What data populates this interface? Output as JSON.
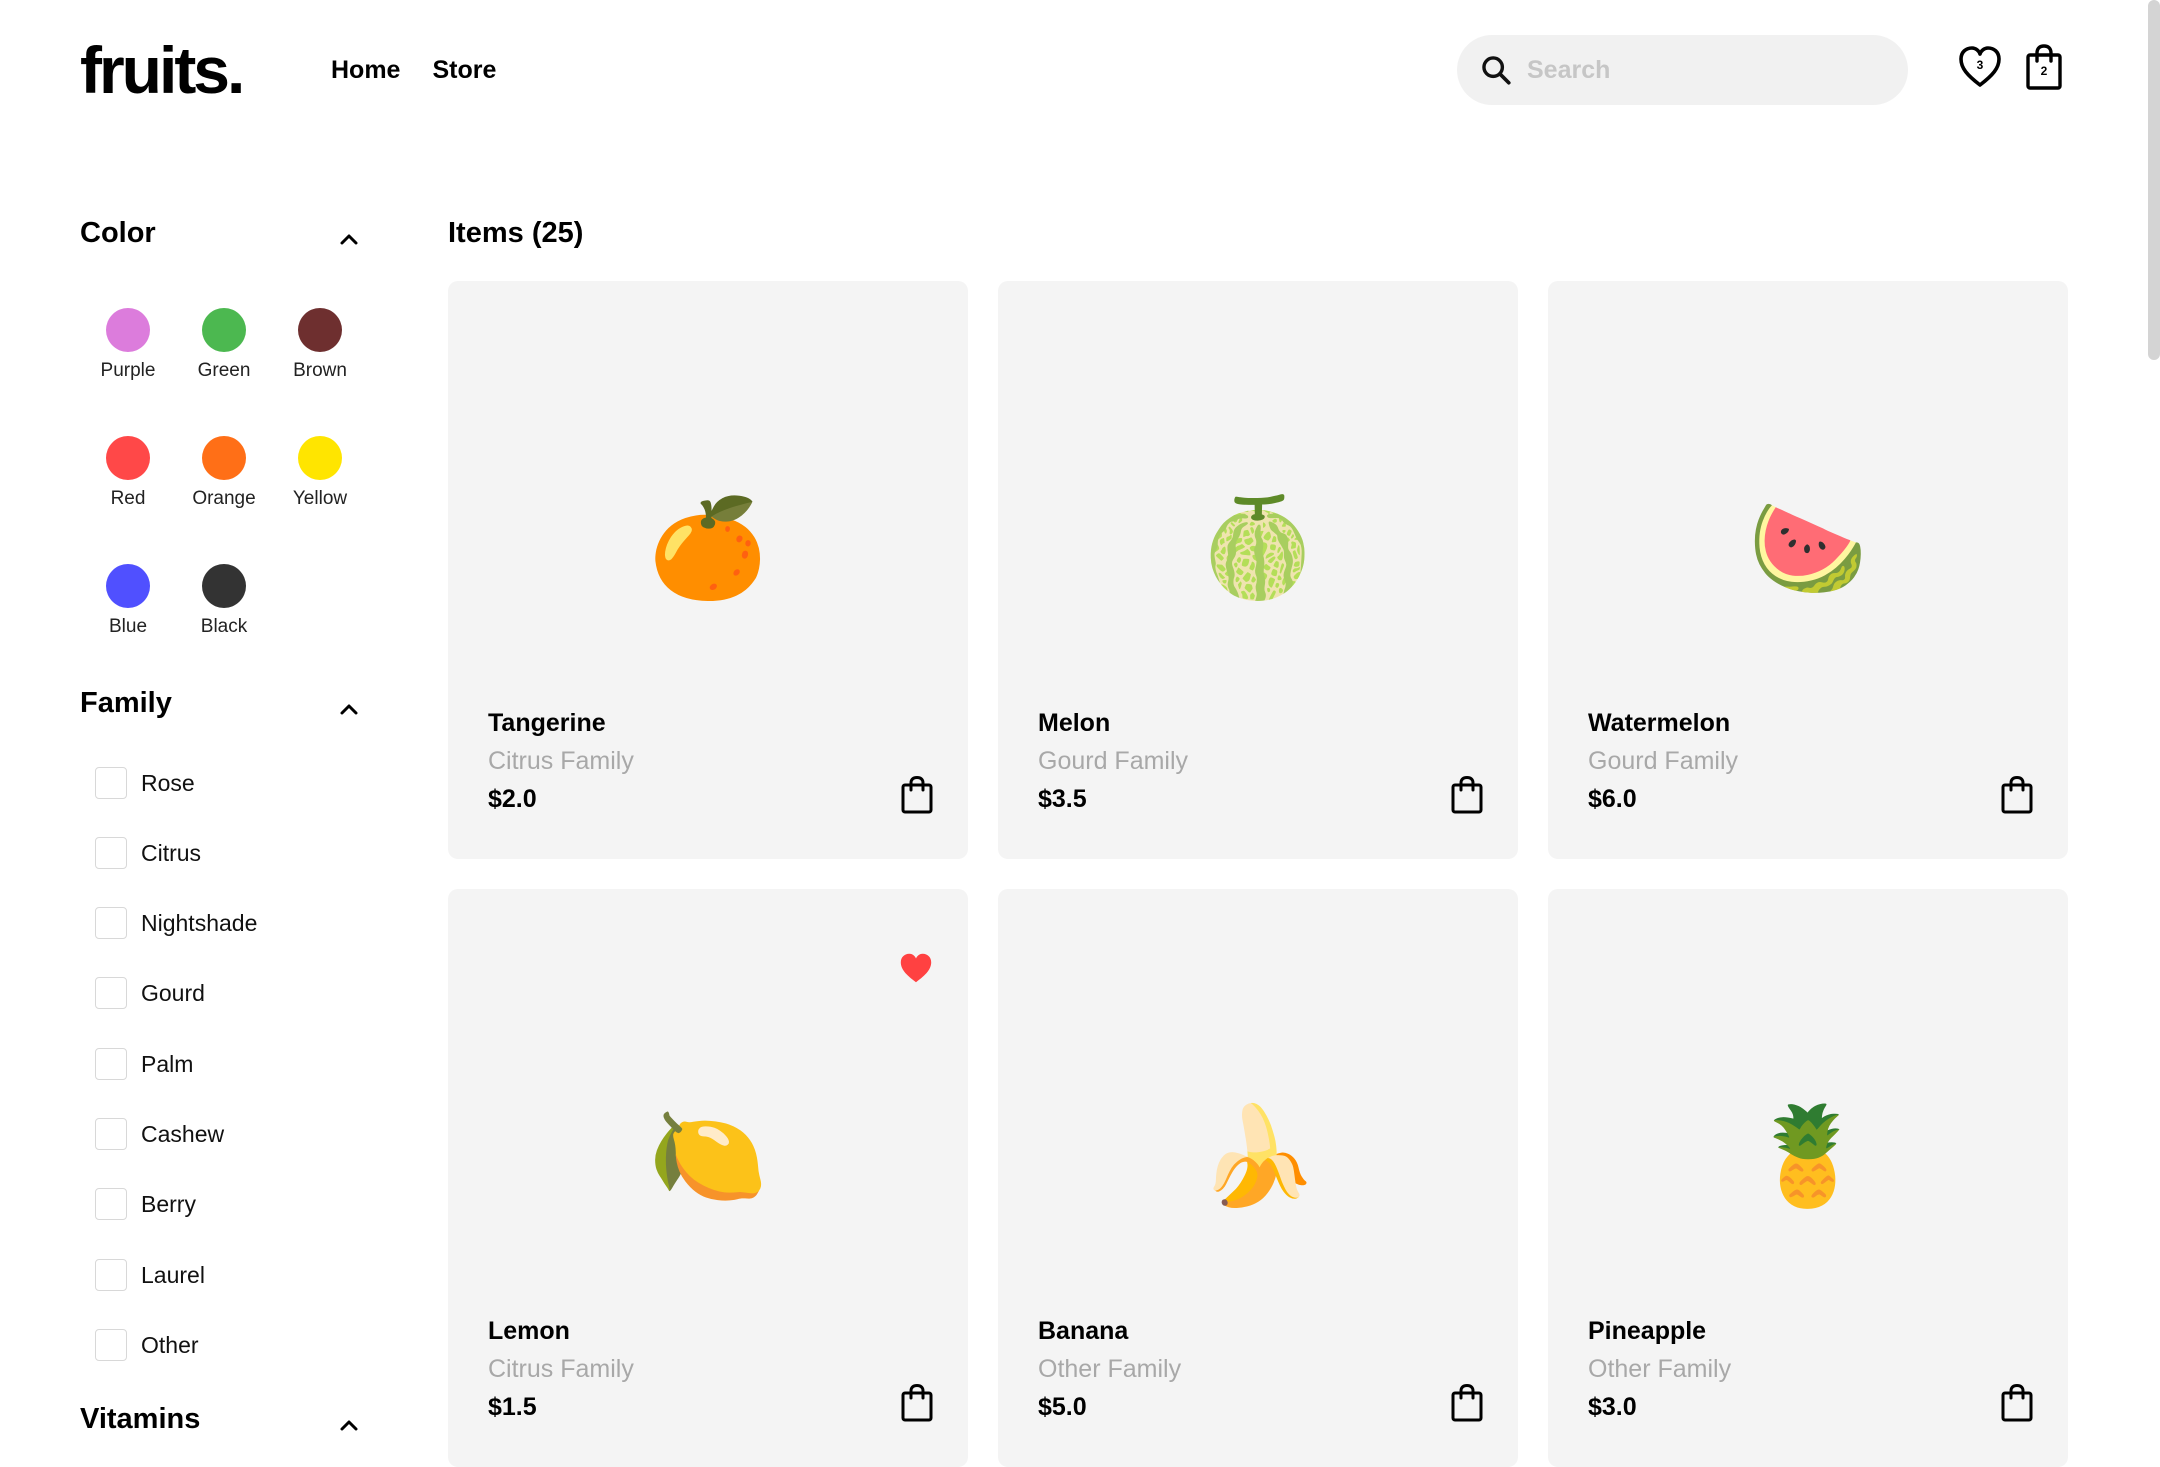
{
  "header": {
    "logo": "fruits.",
    "nav": [
      "Home",
      "Store"
    ],
    "search_placeholder": "Search",
    "wishlist_count": "3",
    "cart_count": "2"
  },
  "sidebar": {
    "color_title": "Color",
    "colors": [
      {
        "label": "Purple",
        "hex": "#dc7cdc"
      },
      {
        "label": "Green",
        "hex": "#4cb850"
      },
      {
        "label": "Brown",
        "hex": "#6e2f2f"
      },
      {
        "label": "Red",
        "hex": "#ff4848"
      },
      {
        "label": "Orange",
        "hex": "#ff6f17"
      },
      {
        "label": "Yellow",
        "hex": "#ffe500"
      },
      {
        "label": "Blue",
        "hex": "#5050ff"
      },
      {
        "label": "Black",
        "hex": "#333333"
      }
    ],
    "family_title": "Family",
    "families": [
      "Rose",
      "Citrus",
      "Nightshade",
      "Gourd",
      "Palm",
      "Cashew",
      "Berry",
      "Laurel",
      "Other"
    ],
    "vitamins_title": "Vitamins"
  },
  "main": {
    "items_title": "Items (25)",
    "cards": [
      {
        "name": "Tangerine",
        "family": "Citrus Family",
        "price": "$2.0",
        "emoji": "🍊",
        "favorite": false
      },
      {
        "name": "Melon",
        "family": "Gourd Family",
        "price": "$3.5",
        "emoji": "🍈",
        "favorite": false
      },
      {
        "name": "Watermelon",
        "family": "Gourd Family",
        "price": "$6.0",
        "emoji": "🍉",
        "favorite": false
      },
      {
        "name": "Lemon",
        "family": "Citrus Family",
        "price": "$1.5",
        "emoji": "🍋",
        "favorite": true
      },
      {
        "name": "Banana",
        "family": "Other Family",
        "price": "$5.0",
        "emoji": "🍌",
        "favorite": false
      },
      {
        "name": "Pineapple",
        "family": "Other Family",
        "price": "$3.0",
        "emoji": "🍍",
        "favorite": false
      }
    ]
  },
  "accent_colors": {
    "favorite_heart": "#ff4141",
    "card_bg": "#f4f4f4",
    "search_bg": "#f1f1f1"
  }
}
